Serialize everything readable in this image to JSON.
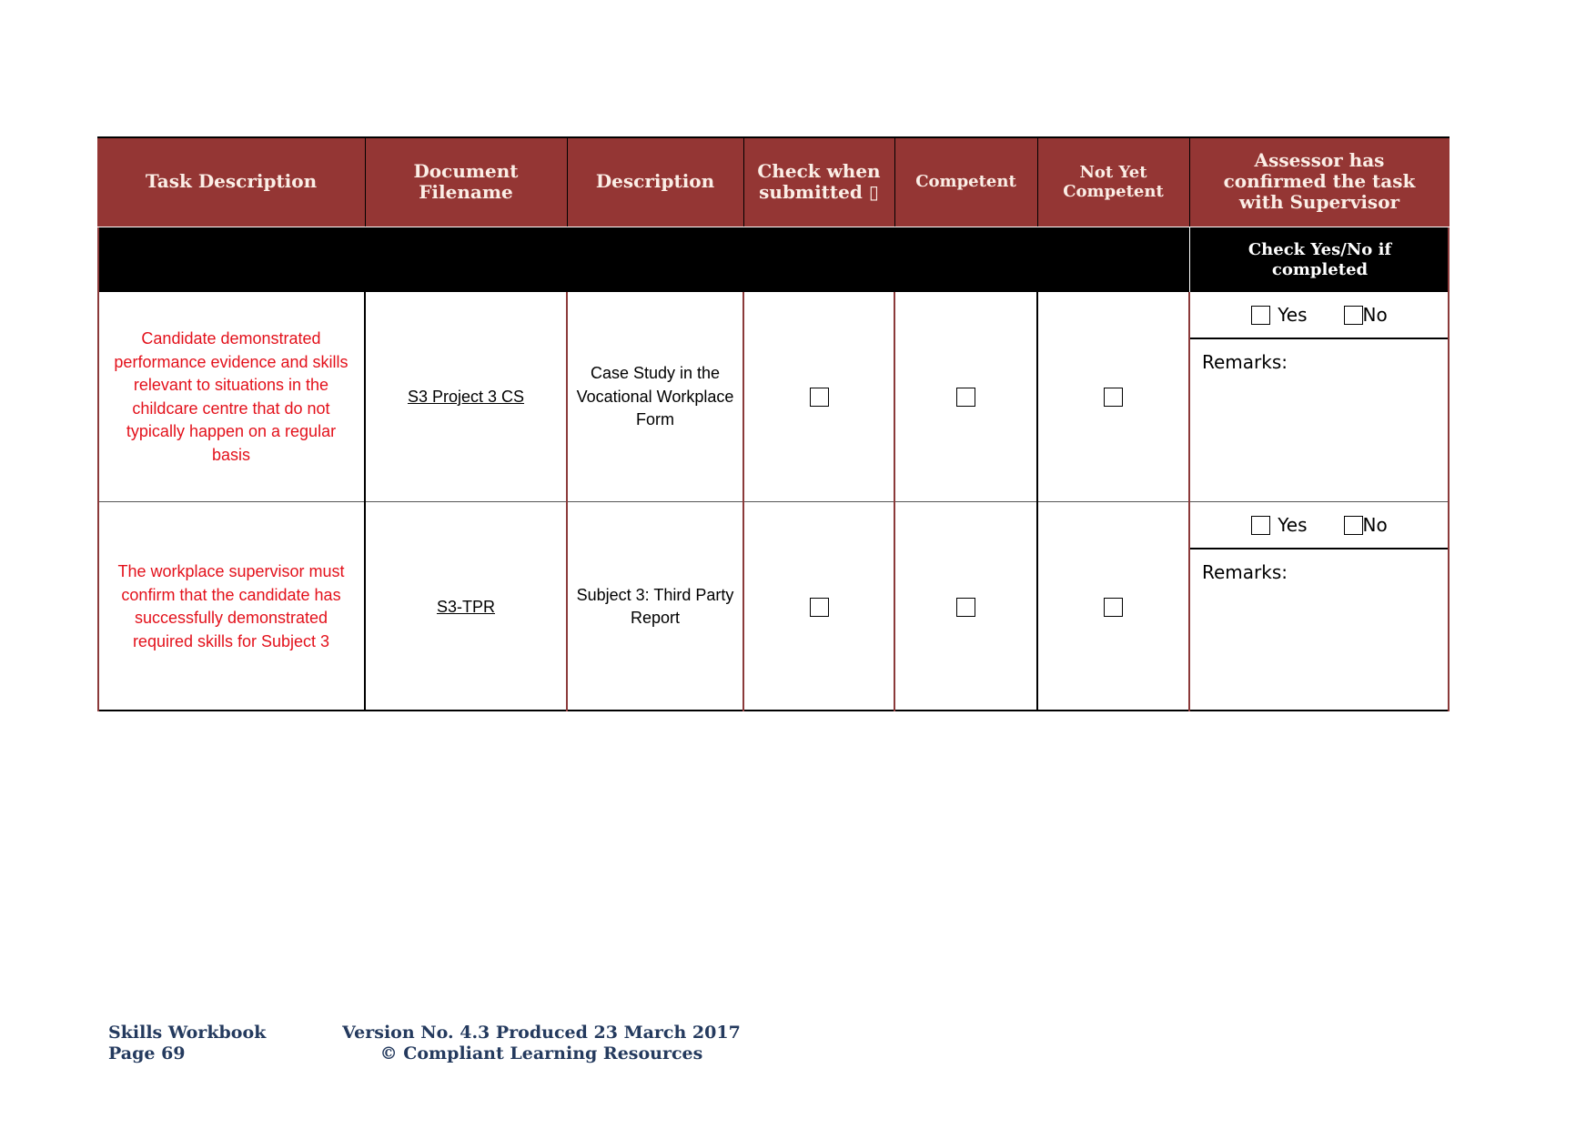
{
  "table": {
    "headers": [
      "Task Description",
      "Document Filename",
      "Description",
      "Check when submitted ▯",
      "Competent",
      "Not Yet Competent",
      "Assessor has confirmed the task with Supervisor"
    ],
    "subheader_right": "Check Yes/No if completed",
    "rows": [
      {
        "task": "Candidate demonstrated performance evidence and skills relevant to situations in the childcare centre that do not typically happen on a regular basis",
        "filename": "S3 Project 3 CS",
        "description": "Case Study in the Vocational Workplace Form",
        "submitted": false,
        "competent": false,
        "not_yet_competent": false,
        "yes_label": "Yes",
        "no_label": "No",
        "yes_checked": false,
        "no_checked": false,
        "remarks_label": "Remarks:"
      },
      {
        "task": "The workplace supervisor must confirm that the candidate has successfully demonstrated required skills for Subject 3",
        "filename": "S3-TPR",
        "description": "Subject 3: Third Party Report",
        "submitted": false,
        "competent": false,
        "not_yet_competent": false,
        "yes_label": "Yes",
        "no_label": "No",
        "yes_checked": false,
        "no_checked": false,
        "remarks_label": "Remarks:"
      }
    ]
  },
  "footer": {
    "workbook": "Skills Workbook",
    "page": "Page 69",
    "version": "Version No. 4.3 Produced 23 March 2017",
    "copyright": "© Compliant Learning Resources"
  },
  "colors": {
    "header_bg": "#943634",
    "task_text": "#e3111b",
    "footer_text": "#243a5e"
  }
}
